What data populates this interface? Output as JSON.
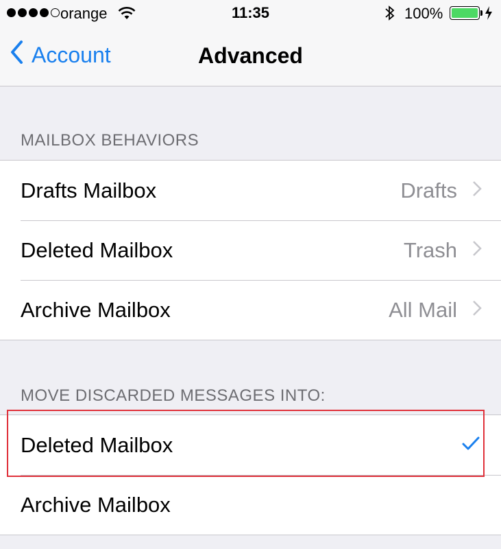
{
  "status_bar": {
    "carrier": "orange",
    "time": "11:35",
    "battery_percent": "100%",
    "signal_bars_filled": 4,
    "signal_bars_total": 5
  },
  "nav": {
    "back_label": "Account",
    "title": "Advanced"
  },
  "mailbox_behaviors": {
    "header": "MAILBOX BEHAVIORS",
    "rows": [
      {
        "label": "Drafts Mailbox",
        "value": "Drafts"
      },
      {
        "label": "Deleted Mailbox",
        "value": "Trash"
      },
      {
        "label": "Archive Mailbox",
        "value": "All Mail"
      }
    ]
  },
  "move_discarded": {
    "header": "MOVE DISCARDED MESSAGES INTO:",
    "rows": [
      {
        "label": "Deleted Mailbox",
        "selected": true
      },
      {
        "label": "Archive Mailbox",
        "selected": false
      }
    ]
  },
  "colors": {
    "accent": "#1a80ee",
    "highlight_border": "#e0303a",
    "battery": "#4cd964"
  }
}
